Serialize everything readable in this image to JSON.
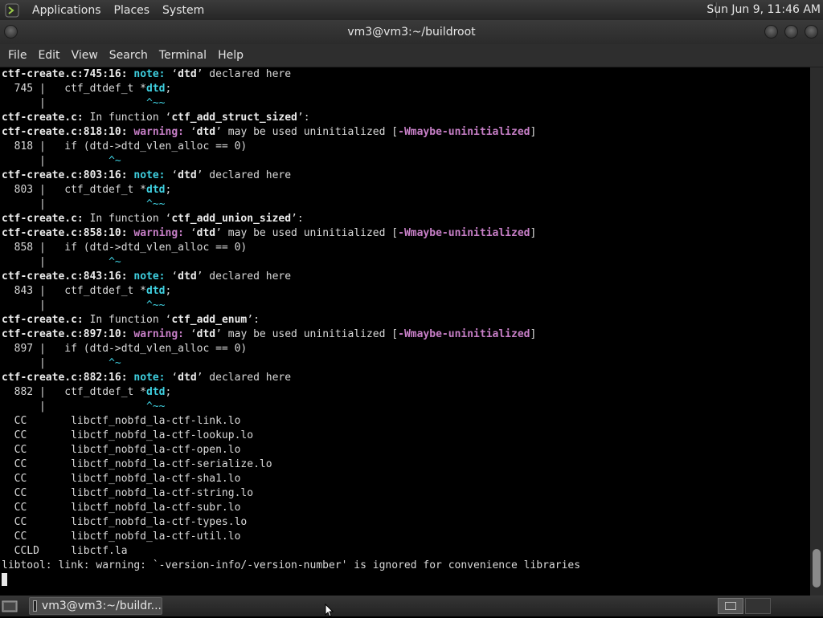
{
  "top_panel": {
    "menus": [
      "Applications",
      "Places",
      "System"
    ],
    "clock": "Sun Jun  9, 11:46 AM"
  },
  "window": {
    "title": "vm3@vm3:~/buildroot",
    "menu": [
      "File",
      "Edit",
      "View",
      "Search",
      "Terminal",
      "Help"
    ]
  },
  "terminal": {
    "lines": [
      "ctf-create.c:745:16: note: ‘dtd’ declared here",
      "  745 |   ctf_dtdef_t *dtd;",
      "      |                ^~~",
      "ctf-create.c: In function ‘ctf_add_struct_sized’:",
      "ctf-create.c:818:10: warning: ‘dtd’ may be used uninitialized [-Wmaybe-uninitialized]",
      "  818 |   if (dtd->dtd_vlen_alloc == 0)",
      "      |          ^~",
      "ctf-create.c:803:16: note: ‘dtd’ declared here",
      "  803 |   ctf_dtdef_t *dtd;",
      "      |                ^~~",
      "ctf-create.c: In function ‘ctf_add_union_sized’:",
      "ctf-create.c:858:10: warning: ‘dtd’ may be used uninitialized [-Wmaybe-uninitialized]",
      "  858 |   if (dtd->dtd_vlen_alloc == 0)",
      "      |          ^~",
      "ctf-create.c:843:16: note: ‘dtd’ declared here",
      "  843 |   ctf_dtdef_t *dtd;",
      "      |                ^~~",
      "ctf-create.c: In function ‘ctf_add_enum’:",
      "ctf-create.c:897:10: warning: ‘dtd’ may be used uninitialized [-Wmaybe-uninitialized]",
      "  897 |   if (dtd->dtd_vlen_alloc == 0)",
      "      |          ^~",
      "ctf-create.c:882:16: note: ‘dtd’ declared here",
      "  882 |   ctf_dtdef_t *dtd;",
      "      |                ^~~",
      "  CC       libctf_nobfd_la-ctf-link.lo",
      "  CC       libctf_nobfd_la-ctf-lookup.lo",
      "  CC       libctf_nobfd_la-ctf-open.lo",
      "  CC       libctf_nobfd_la-ctf-serialize.lo",
      "  CC       libctf_nobfd_la-ctf-sha1.lo",
      "  CC       libctf_nobfd_la-ctf-string.lo",
      "  CC       libctf_nobfd_la-ctf-subr.lo",
      "  CC       libctf_nobfd_la-ctf-types.lo",
      "  CC       libctf_nobfd_la-ctf-util.lo",
      "  CCLD     libctf.la",
      "libtool: link: warning: `-version-info/-version-number' is ignored for convenience libraries"
    ]
  },
  "taskbar": {
    "task_label": "vm3@vm3:~/buildr..."
  }
}
